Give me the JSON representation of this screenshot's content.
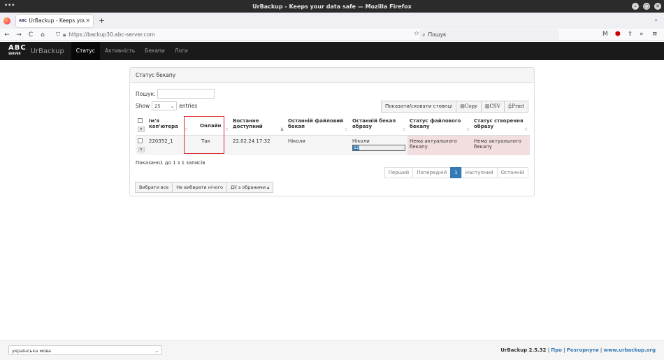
{
  "window": {
    "title": "UrBackup - Keeps your data safe — Mozilla Firefox",
    "menu_dots": "•••",
    "ctrl_min": "–",
    "ctrl_max": "▢",
    "ctrl_close": "✕"
  },
  "tabs": [
    {
      "label": "UrBackup - Keeps your data safe",
      "favicon": "ABC",
      "close": "✕"
    }
  ],
  "browser": {
    "new_tab": "+",
    "url": "https://backup30.abc-server.com",
    "search_placeholder": "Пошук",
    "back": "←",
    "forward": "→",
    "reload": "C",
    "home": "⌂",
    "bookmark": "☆",
    "search_icon": "⌕",
    "ext_mail": "M",
    "ext_shield": "⬢",
    "ext_share": "⇪",
    "ext_more": "»",
    "ext_menu": "≡",
    "tab_overflow": "⌄"
  },
  "app": {
    "logo_text": "ABC",
    "logo_sub": "SERVER",
    "brand": "UrBackup",
    "nav": [
      "Статус",
      "Активність",
      "Бекапи",
      "Логи"
    ]
  },
  "panel": {
    "heading": "Статус бекапу",
    "search_label": "Пошук:",
    "show_label": "Show",
    "entries_label": "entries",
    "page_size": "25",
    "buttons": [
      "Показати/сховати стовпці",
      "Copy",
      "CSV",
      "Print"
    ],
    "columns": [
      "Ім'я коп'ютера",
      "Онлайн",
      "Востанне доступний",
      "Останній файловий бекап",
      "Останній бекап образу",
      "Статус файлового бекапу",
      "Статус створення образу"
    ],
    "rows": [
      {
        "name": "220352_1",
        "online": "Так",
        "last_seen": "22.02.24 17:32",
        "last_file_backup": "Ніколи",
        "last_image_backup": "Ніколи",
        "image_progress": "12%",
        "file_status": "Нема актуального бекапу",
        "image_status": "Нема актуального бекапу"
      }
    ],
    "info": "Показано1 до 1 з 1 записів",
    "pagination": [
      "Перший",
      "Попередній",
      "1",
      "Наступний",
      "Останній"
    ],
    "bulk_actions": [
      "Вибрати все",
      "Не вибирати нічого",
      "Дії з обраними ▴"
    ]
  },
  "footer": {
    "language": "українська мова",
    "version": "UrBackup 2.5.32",
    "sep": "|",
    "links": [
      "Про",
      "Розгорнути",
      "www.urbackup.org"
    ]
  },
  "colors": {
    "header_bg": "#1a1a1a",
    "accent": "#337ab7",
    "danger_bg": "#f2dede",
    "highlight_border": "#d9262c"
  }
}
